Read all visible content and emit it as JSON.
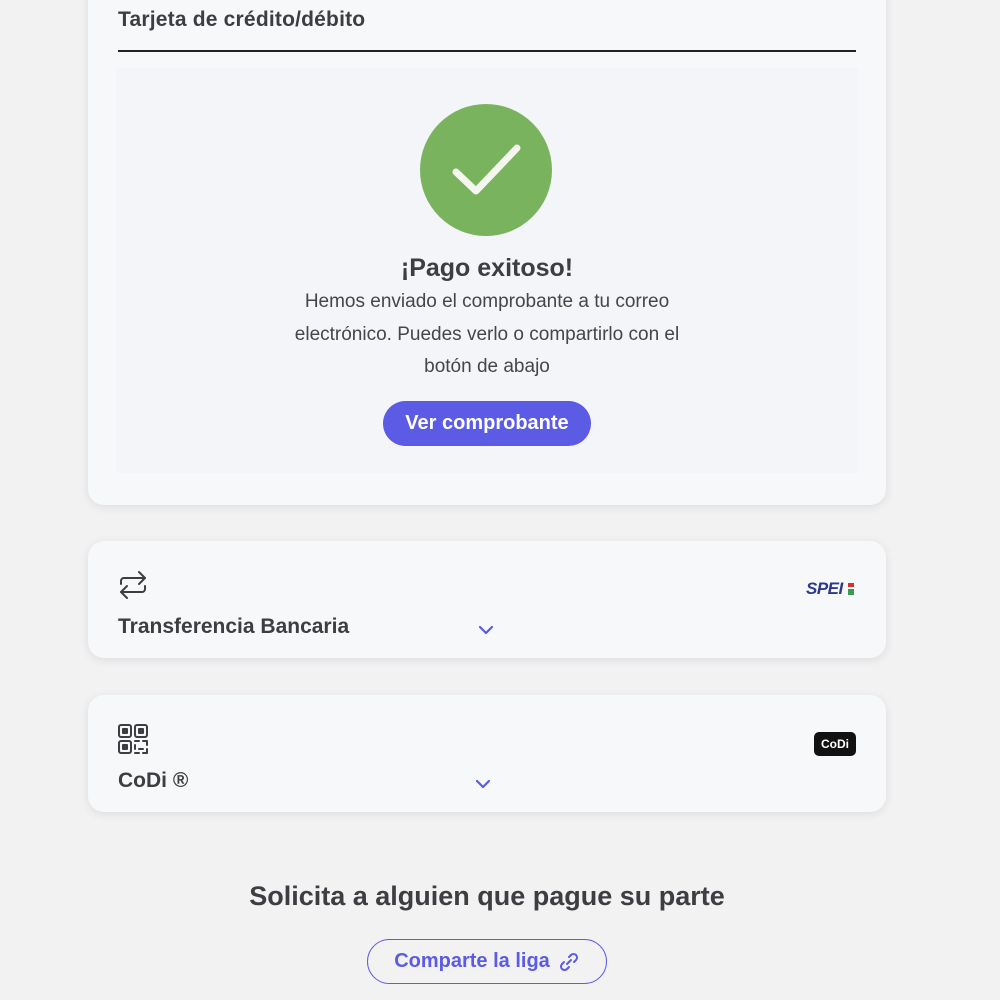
{
  "card_payment": {
    "title": "Tarjeta de crédito/débito",
    "success": {
      "title": "¡Pago exitoso!",
      "message": "Hemos enviado el comprobante a tu correo electrónico. Puedes verlo o compartirlo con el botón de abajo",
      "button_label": "Ver comprobante",
      "icon": "check-icon"
    }
  },
  "transfer": {
    "label": "Transferencia Bancaria",
    "icon": "transfer-arrows-icon",
    "logo_text": "SPEI"
  },
  "codi": {
    "label": "CoDi ®",
    "icon": "qr-code-icon",
    "logo_text": "CoDi"
  },
  "share": {
    "title": "Solicita a alguien que pague su parte",
    "button_label": "Comparte la liga",
    "icon": "link-icon"
  },
  "colors": {
    "accent": "#5b5be6",
    "success": "#79b35e",
    "background": "#f2f2f3",
    "card": "#f7f8fa"
  }
}
